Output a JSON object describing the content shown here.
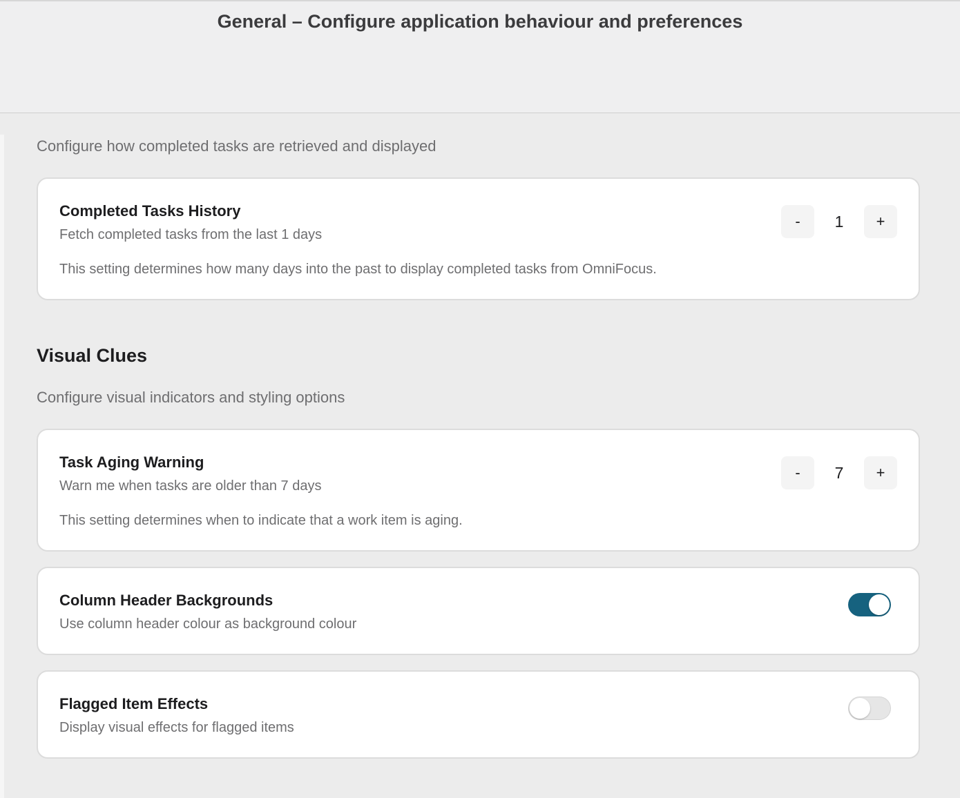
{
  "header": {
    "title": "General – Configure application behaviour and preferences"
  },
  "completed_section": {
    "description": "Configure how completed tasks are retrieved and displayed",
    "card": {
      "title": "Completed Tasks History",
      "subtitle": "Fetch completed tasks from the last 1 days",
      "note": "This setting determines how many days into the past to display completed tasks from OmniFocus.",
      "minus_label": "-",
      "value": "1",
      "plus_label": "+"
    }
  },
  "visual_clues": {
    "title": "Visual Clues",
    "description": "Configure visual indicators and styling options",
    "aging": {
      "title": "Task Aging Warning",
      "subtitle": "Warn me when tasks are older than 7 days",
      "note": "This setting determines when to indicate that a work item is aging.",
      "minus_label": "-",
      "value": "7",
      "plus_label": "+"
    },
    "column_backgrounds": {
      "title": "Column Header Backgrounds",
      "subtitle": "Use column header colour as background colour",
      "enabled": true
    },
    "flagged_effects": {
      "title": "Flagged Item Effects",
      "subtitle": "Display visual effects for flagged items",
      "enabled": false
    }
  },
  "colors": {
    "toggle_on": "#16627f",
    "toggle_off": "#e6e6e6",
    "background": "#ebebeb"
  }
}
